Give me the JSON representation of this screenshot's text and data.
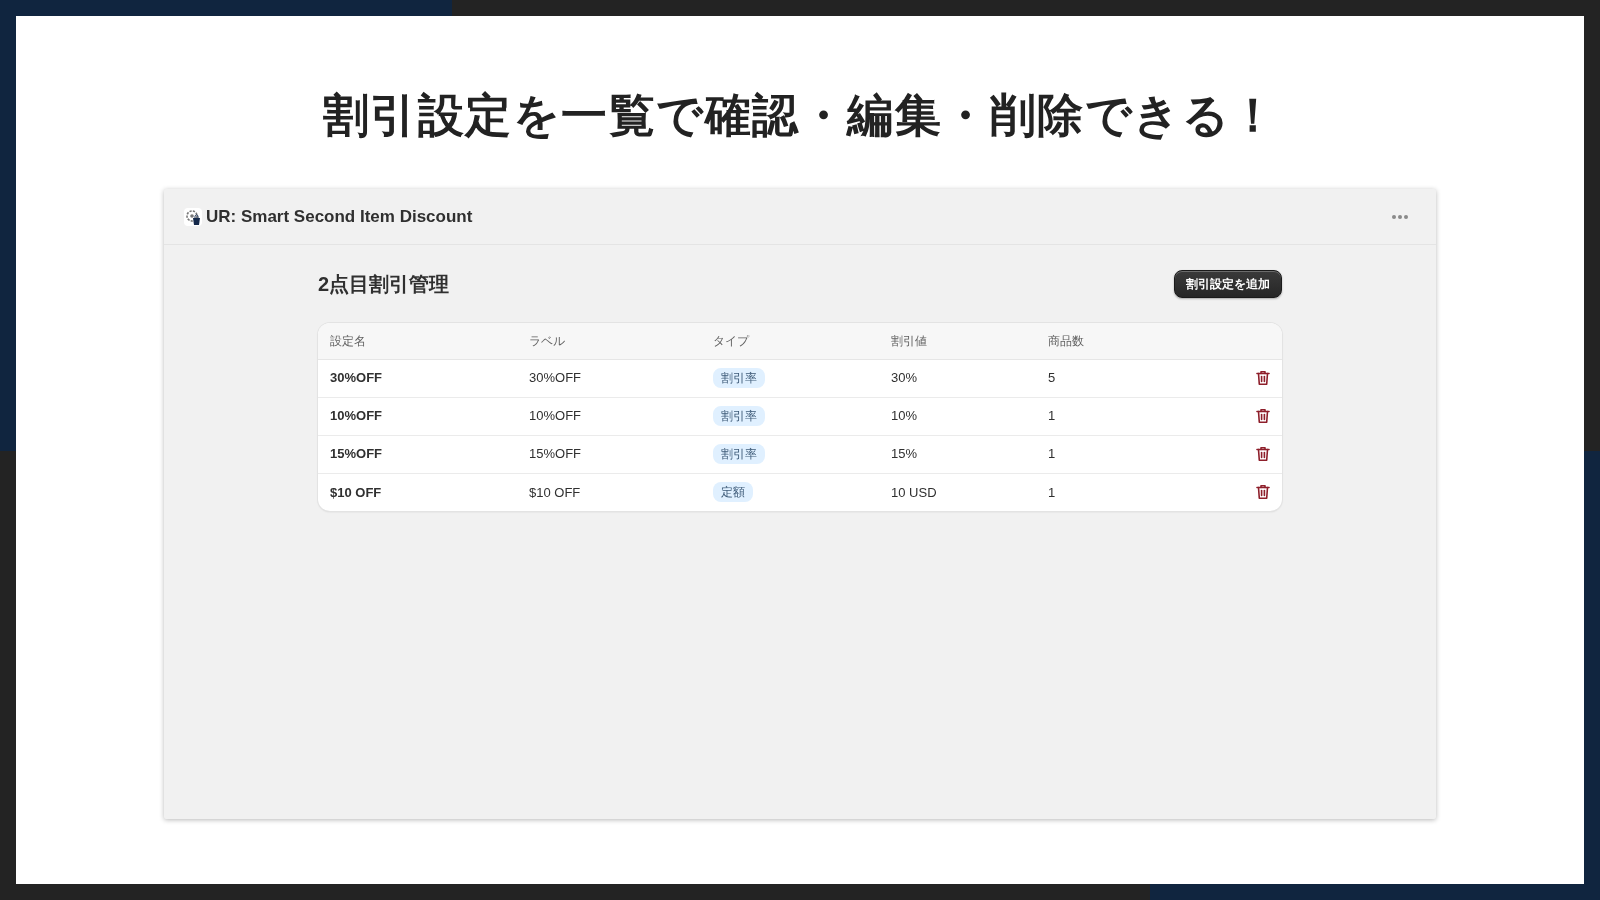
{
  "headline": "割引設定を一覧で確認・編集・削除できる！",
  "app_window": {
    "title": "UR: Smart Second Item Discount"
  },
  "page": {
    "title": "2点目割引管理",
    "primary_button": "割引設定を追加"
  },
  "table": {
    "columns": [
      "設定名",
      "ラベル",
      "タイプ",
      "割引値",
      "商品数"
    ],
    "rows": [
      {
        "name": "30%OFF",
        "label": "30%OFF",
        "type": "割引率",
        "value": "30%",
        "product_count": "5"
      },
      {
        "name": "10%OFF",
        "label": "10%OFF",
        "type": "割引率",
        "value": "10%",
        "product_count": "1"
      },
      {
        "name": "15%OFF",
        "label": "15%OFF",
        "type": "割引率",
        "value": "15%",
        "product_count": "1"
      },
      {
        "name": "$10 OFF",
        "label": "$10 OFF",
        "type": "定額",
        "value": "10 USD",
        "product_count": "1"
      }
    ]
  }
}
